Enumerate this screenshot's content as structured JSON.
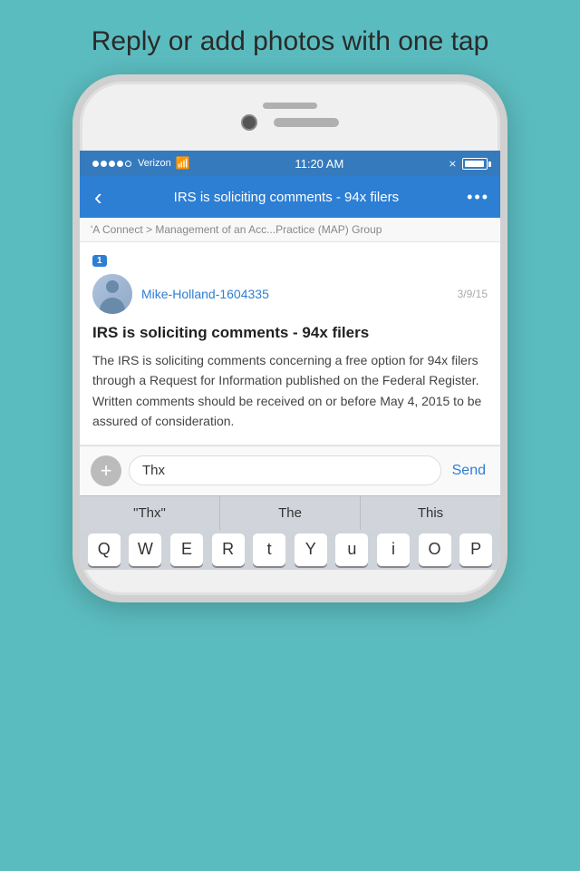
{
  "tagline": "Reply or add photos with one tap",
  "status_bar": {
    "signal": [
      "filled",
      "filled",
      "filled",
      "filled",
      "empty"
    ],
    "carrier": "Verizon",
    "time": "11:20 AM"
  },
  "nav": {
    "back_label": "‹",
    "title": "IRS is soliciting comments - 94x filers",
    "dots": "•••"
  },
  "breadcrumb": "'A Connect  >  Management of an Acc...Practice (MAP) Group",
  "post": {
    "badge": "1",
    "author": "Mike-Holland-1604335",
    "date": "3/9/15",
    "title": "IRS is soliciting comments - 94x filers",
    "body": "The IRS is soliciting comments concerning a free option for 94x filers through a Request for Information published on the Federal Register. Written comments should be received on or before May 4, 2015 to be assured of consideration."
  },
  "reply": {
    "plus_icon": "+",
    "input_value": "Thx",
    "send_label": "Send"
  },
  "autocomplete": {
    "items": [
      "\"Thx\"",
      "The",
      "This"
    ]
  },
  "keyboard_keys": [
    "Q",
    "W",
    "E",
    "R",
    "T",
    "Y",
    "U",
    "I",
    "O",
    "P"
  ]
}
